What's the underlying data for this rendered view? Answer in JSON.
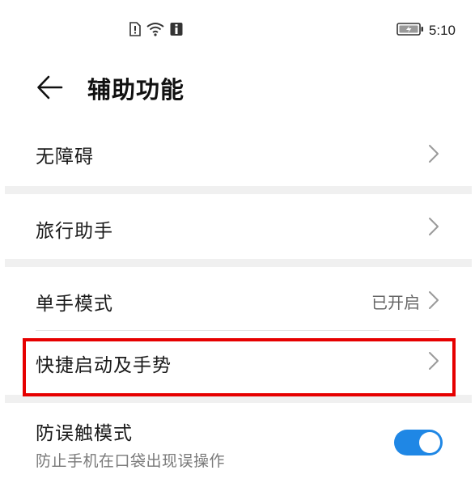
{
  "status_bar": {
    "time": "5:10",
    "icons": [
      "sim-alert-icon",
      "wifi-icon",
      "info-icon",
      "battery-charging-icon"
    ]
  },
  "header": {
    "back_icon": "back-arrow-icon",
    "title": "辅助功能"
  },
  "items": [
    {
      "label": "无障碍",
      "icon": "chevron-right-icon"
    },
    {
      "label": "旅行助手",
      "icon": "chevron-right-icon"
    },
    {
      "label": "单手模式",
      "value": "已开启",
      "icon": "chevron-right-icon"
    },
    {
      "label": "快捷启动及手势",
      "icon": "chevron-right-icon"
    },
    {
      "label": "防误触模式",
      "subtitle": "防止手机在口袋出现误操作",
      "toggle": true
    }
  ],
  "colors": {
    "accent": "#1f87e5",
    "highlight": "#e60000",
    "separator": "#f0f0f0"
  }
}
